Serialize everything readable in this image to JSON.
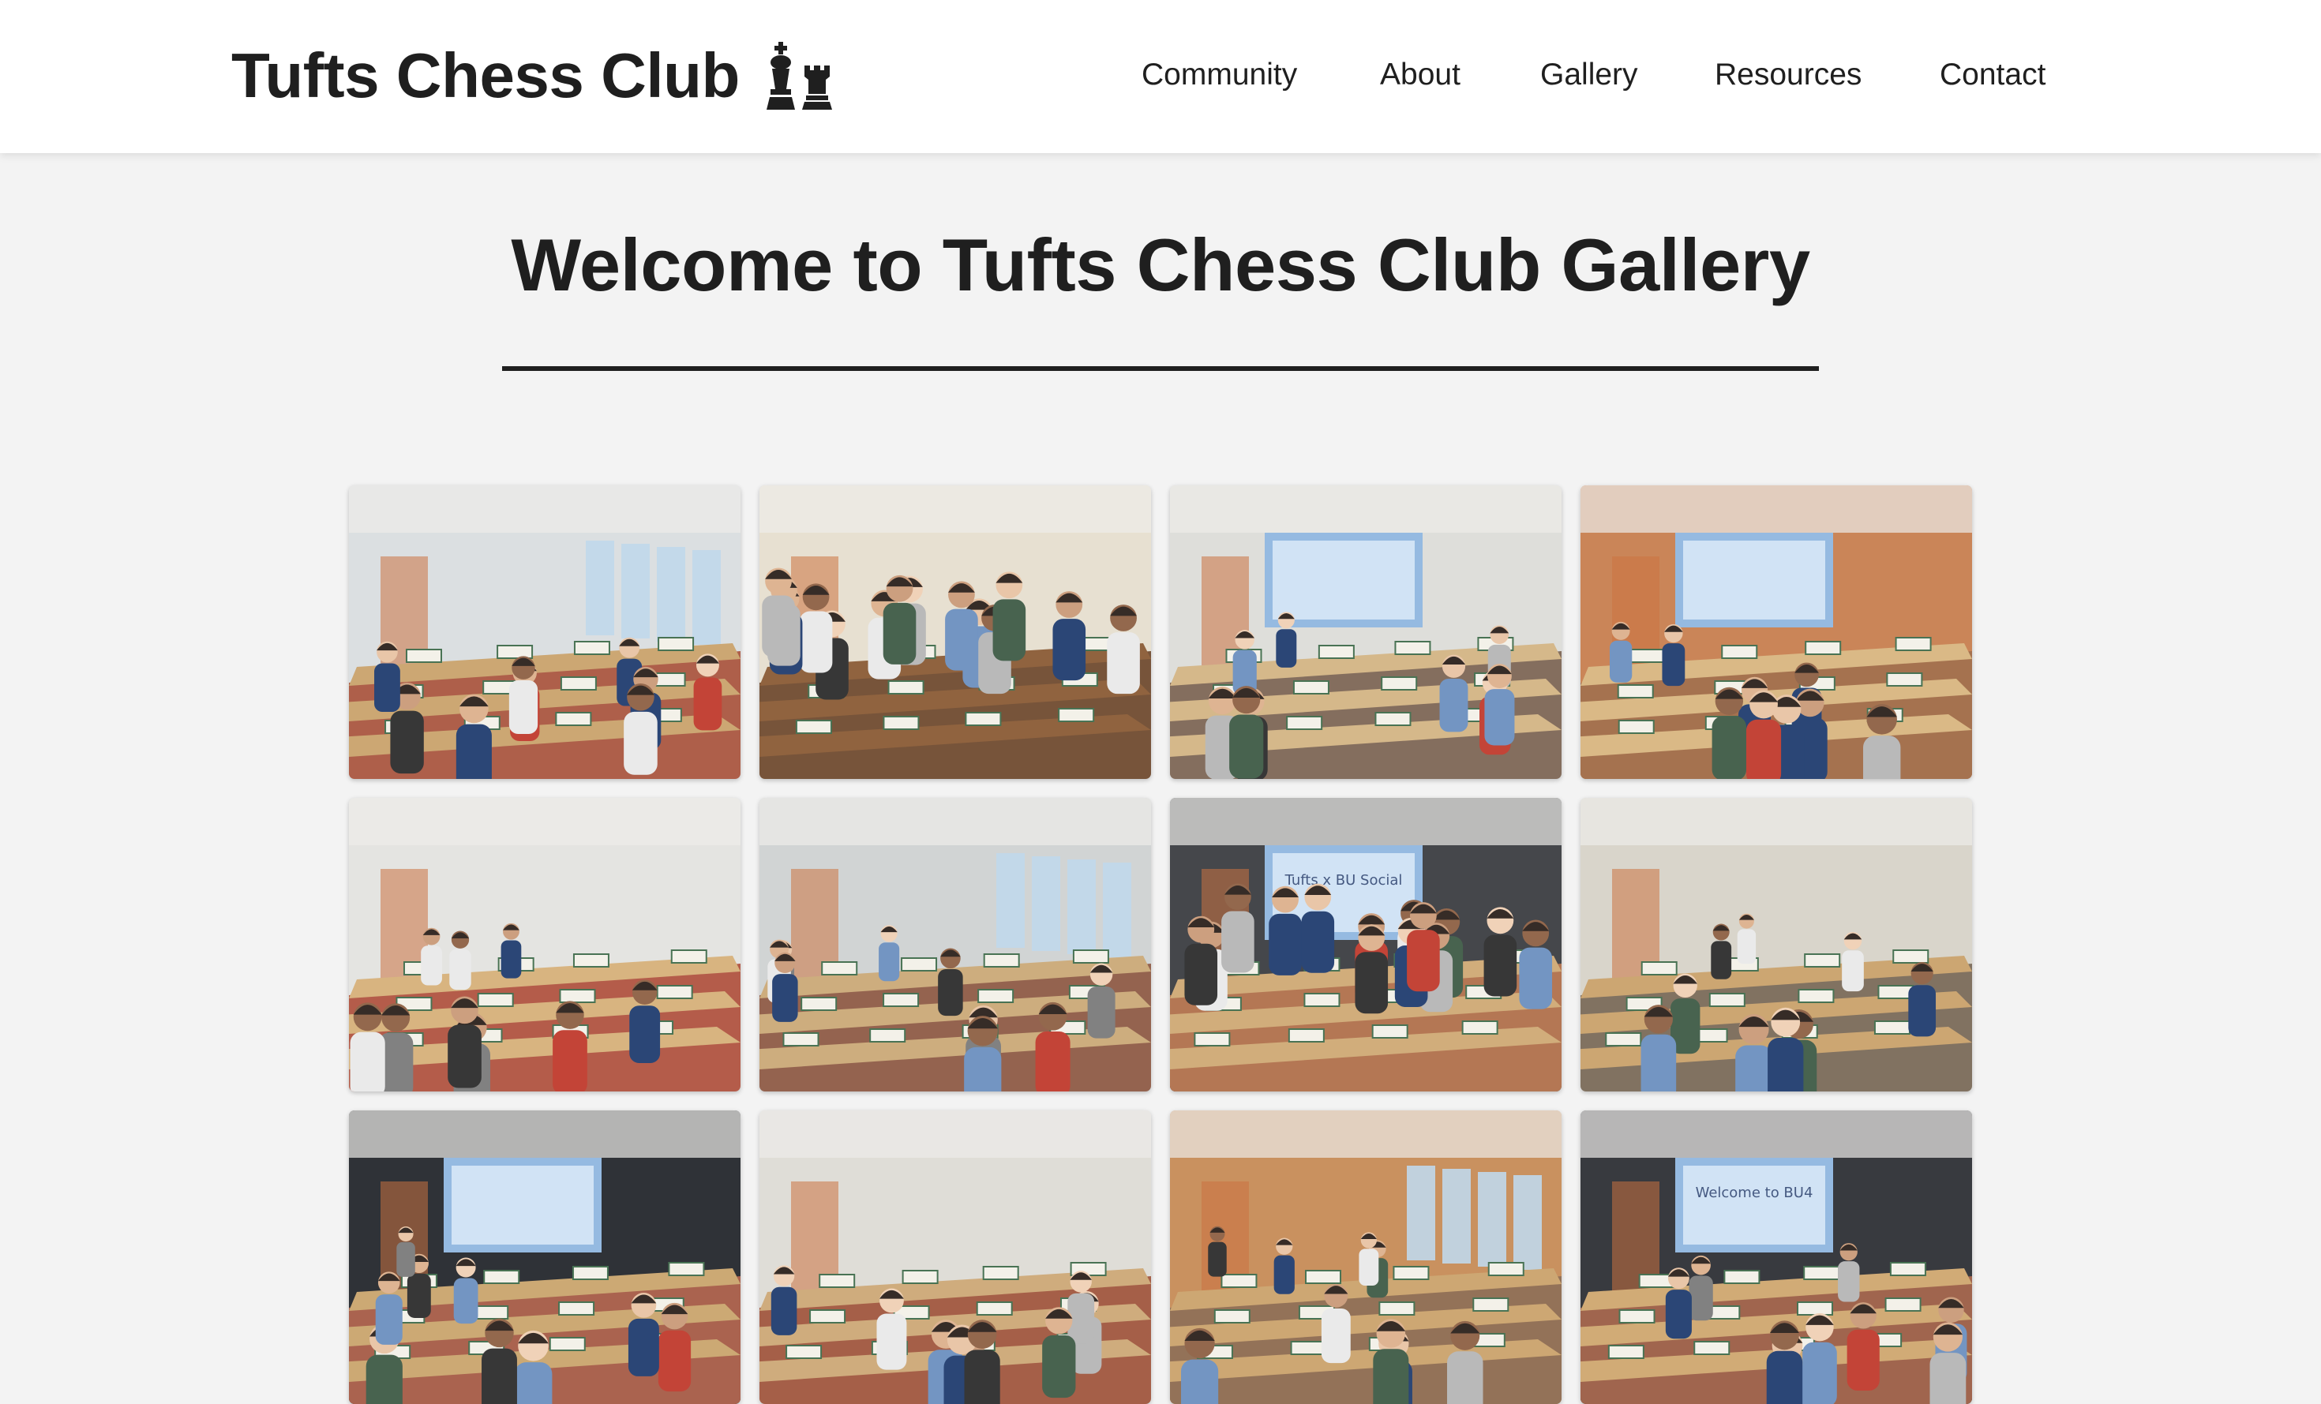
{
  "site": {
    "brand": "Tufts Chess Club",
    "brand_icons": [
      "chess-king-icon",
      "chess-rook-icon"
    ]
  },
  "nav": {
    "items": [
      {
        "label": "Community"
      },
      {
        "label": "About"
      },
      {
        "label": "Gallery"
      },
      {
        "label": "Resources"
      },
      {
        "label": "Contact"
      }
    ]
  },
  "hero": {
    "title": "Welcome to Tufts Chess Club Gallery"
  },
  "gallery": {
    "photos": [
      {
        "scene": "players-selfie",
        "projector_text": "",
        "colors": {
          "wall": "#d9dde0",
          "floor": "#a9563f",
          "table": "#c9a26b"
        }
      },
      {
        "scene": "group-portrait",
        "projector_text": "",
        "colors": {
          "wall": "#e6dfcf",
          "floor": "#6f4a2e",
          "table": "#8a5a33"
        }
      },
      {
        "scene": "classroom-play",
        "projector_text": "",
        "colors": {
          "wall": "#dcdcd8",
          "floor": "#7d6554",
          "table": "#d3b483"
        }
      },
      {
        "scene": "lecture-hall",
        "projector_text": "",
        "colors": {
          "wall": "#c77e4e",
          "floor": "#a06a45",
          "table": "#d8b57f"
        }
      },
      {
        "scene": "wide-room",
        "projector_text": "",
        "colors": {
          "wall": "#e3e3e0",
          "floor": "#b0523f",
          "table": "#d6b079"
        }
      },
      {
        "scene": "window-room",
        "projector_text": "",
        "colors": {
          "wall": "#cfd2d2",
          "floor": "#8e5a45",
          "table": "#caa876"
        }
      },
      {
        "scene": "group-stage",
        "projector_text": "Tufts x BU Social",
        "colors": {
          "wall": "#3a3c40",
          "floor": "#b06f4a",
          "table": "#cfa873"
        }
      },
      {
        "scene": "big-board",
        "projector_text": "",
        "colors": {
          "wall": "#d7d3c8",
          "floor": "#7a6a58",
          "table": "#c9a16a"
        }
      },
      {
        "scene": "lecture-hall-blue",
        "projector_text": "",
        "colors": {
          "wall": "#23262b",
          "floor": "#a55a45",
          "table": "#c9a46c"
        }
      },
      {
        "scene": "crowd-room",
        "projector_text": "",
        "colors": {
          "wall": "#dedbd5",
          "floor": "#a0553d",
          "table": "#cda775"
        }
      },
      {
        "scene": "sunny-room",
        "projector_text": "",
        "colors": {
          "wall": "#c68b55",
          "floor": "#8d6a4e",
          "table": "#caa26b"
        }
      },
      {
        "scene": "screen-room",
        "projector_text": "Welcome to BU4",
        "colors": {
          "wall": "#2c2e33",
          "floor": "#9b5c43",
          "table": "#cfa66e"
        }
      }
    ]
  }
}
